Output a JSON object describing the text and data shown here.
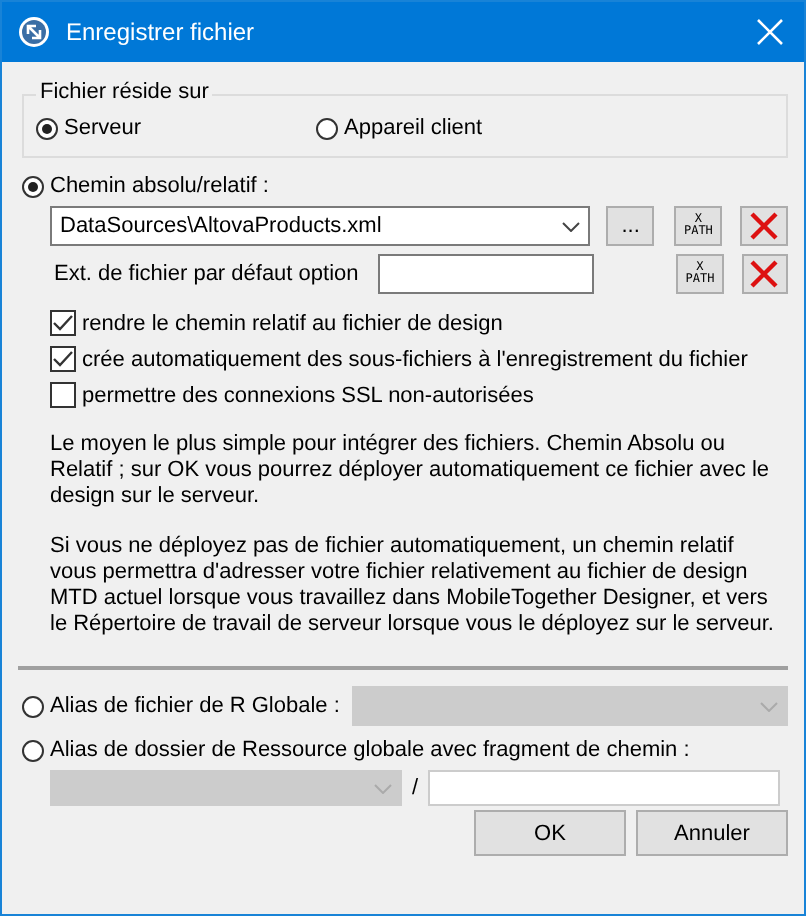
{
  "window": {
    "title": "Enregistrer fichier"
  },
  "location": {
    "legend": "Fichier réside sur",
    "options": [
      {
        "label": "Serveur",
        "selected": true
      },
      {
        "label": "Appareil client",
        "selected": false
      }
    ]
  },
  "path_source": {
    "label": "Chemin absolu/relatif :",
    "selected": true
  },
  "path_row": {
    "value": "DataSources\\AltovaProducts.xml",
    "browse": "...",
    "xpath": [
      "X",
      "PATH"
    ]
  },
  "ext_row": {
    "label": "Ext. de fichier par défaut option",
    "xpath": [
      "X",
      "PATH"
    ]
  },
  "checkboxes": [
    {
      "label": "rendre le chemin relatif au fichier de design",
      "checked": true
    },
    {
      "label": "crée automatiquement des sous-fichiers à l'enregistrement du fichier",
      "checked": true
    },
    {
      "label": "permettre des connexions SSL non-autorisées",
      "checked": false
    }
  ],
  "notes": [
    "Le moyen le plus simple pour intégrer des fichiers. Chemin Absolu ou Relatif ; sur OK vous pourrez déployer automatiquement ce fichier avec le design sur le serveur.",
    "Si vous ne déployez pas de fichier automatiquement, un chemin relatif vous permettra d'adresser votre fichier relativement au fichier de design MTD actuel lorsque vous travaillez dans MobileTogether Designer, et vers le Répertoire de travail de serveur lorsque vous le déployez sur le serveur."
  ],
  "global_file": {
    "label": "Alias de fichier de R Globale :",
    "selected": false,
    "combo_disabled": true
  },
  "global_folder": {
    "label": "Alias de dossier de Ressource globale avec fragment de chemin :",
    "selected": false,
    "combo_disabled": true,
    "separator": "/"
  },
  "buttons": [
    "OK",
    "Annuler"
  ]
}
